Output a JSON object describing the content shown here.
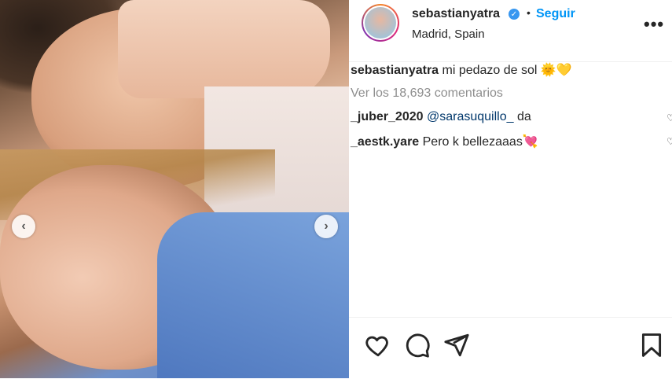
{
  "post": {
    "nav_prev_icon": "chevron-left-icon",
    "nav_next_icon": "chevron-right-icon"
  },
  "header": {
    "username": "sebastianyatra",
    "verified_icon": "verified-badge-icon",
    "separator": "•",
    "follow_label": "Seguir",
    "location": "Madrid, Spain",
    "more_label": "•••"
  },
  "caption": {
    "username": "sebastianyatra",
    "text": " mi pedazo de sol 🌞💛"
  },
  "view_comments_label": "Ver los 18,693 comentarios",
  "comments": [
    {
      "username": "_juber_2020",
      "mention": "@sarasuquillo_",
      "text": " da"
    },
    {
      "username": "_aestk.yare",
      "mention": "",
      "text": " Pero k bellezaaas💘"
    }
  ],
  "actions": {
    "like_icon": "heart-icon",
    "comment_icon": "comment-icon",
    "share_icon": "paper-plane-icon",
    "save_icon": "bookmark-icon"
  },
  "colors": {
    "follow": "#0095f6",
    "verified": "#3897f0",
    "text": "#262626",
    "muted": "#8e8e8e",
    "mention": "#00376b"
  }
}
